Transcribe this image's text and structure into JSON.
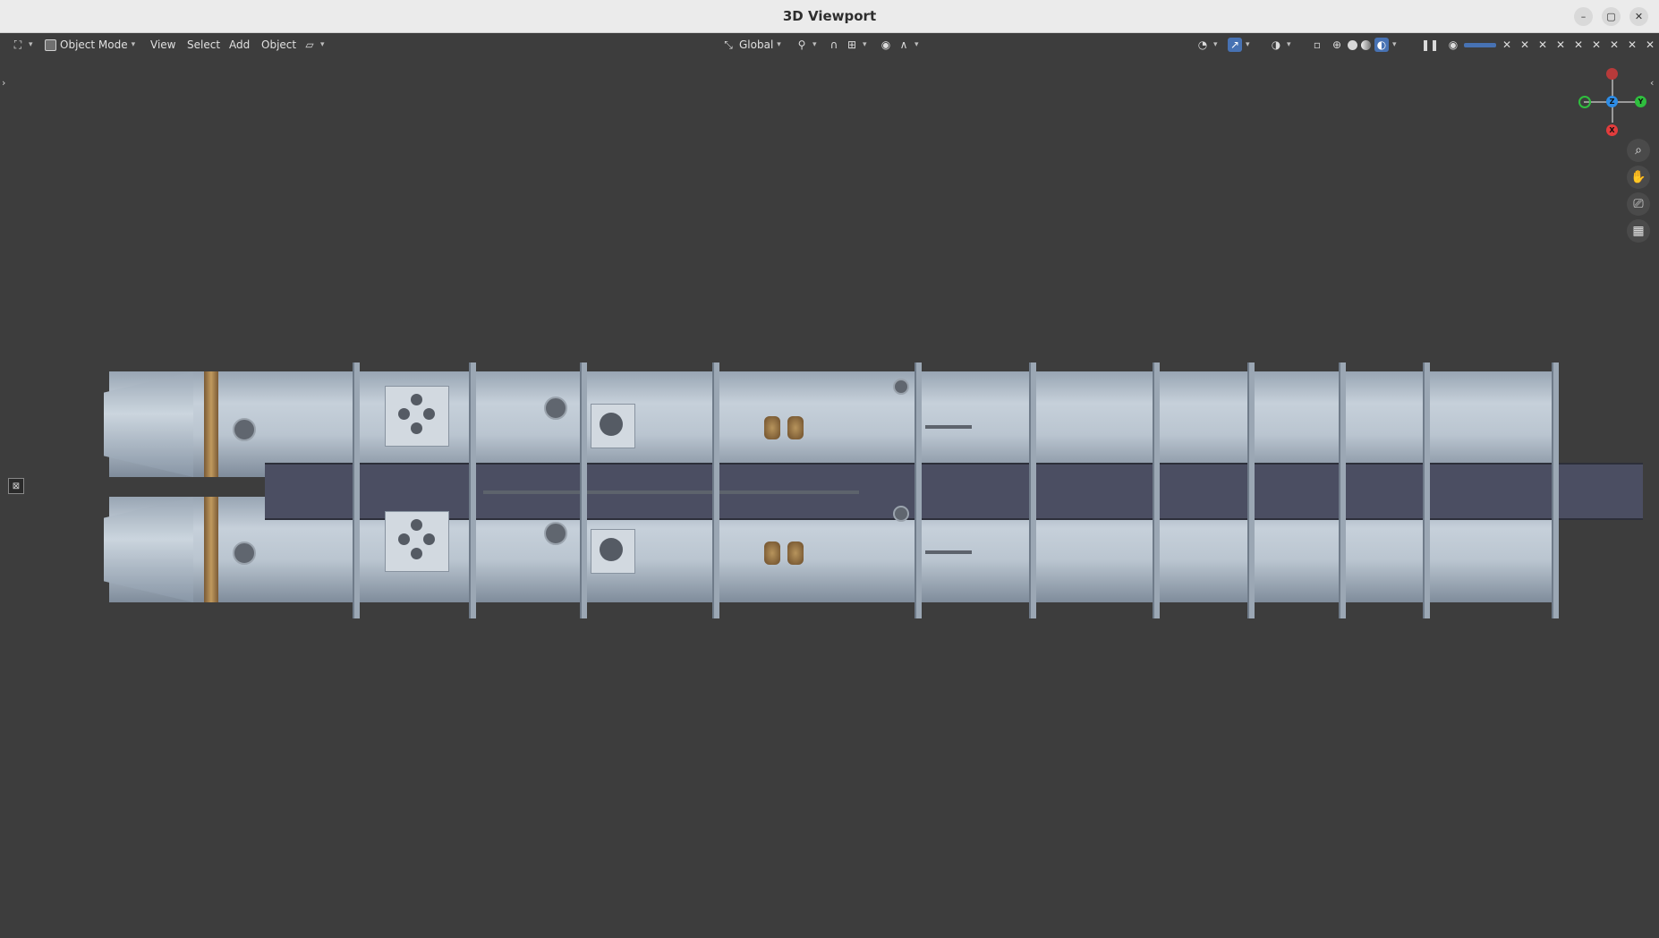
{
  "window": {
    "title": "3D Viewport",
    "controls": [
      "–",
      "▢",
      "✕"
    ]
  },
  "header": {
    "mode_label": "Object Mode",
    "menus": [
      "View",
      "Select",
      "Add",
      "Object"
    ],
    "orientation_label": "Global"
  },
  "gizmo": {
    "z_label": "Z",
    "y_label": "Y",
    "x_label": "X"
  },
  "colors": {
    "accent": "#4772b3",
    "axis_x": "#e23c3c",
    "axis_y": "#2fbf3e",
    "axis_z": "#2d8ce6"
  },
  "nav_buttons": [
    "zoom-icon",
    "pan-hand-icon",
    "camera-icon",
    "grid-icon"
  ]
}
